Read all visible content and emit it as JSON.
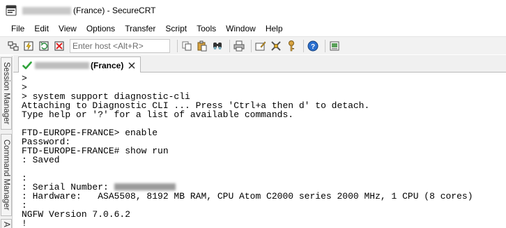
{
  "window": {
    "title_suffix": "(France) - SecureCRT",
    "app_icon": "securecrt-icon"
  },
  "menu": {
    "items": [
      "File",
      "Edit",
      "View",
      "Options",
      "Transfer",
      "Script",
      "Tools",
      "Window",
      "Help"
    ]
  },
  "toolbar": {
    "host_placeholder": "Enter host <Alt+R>",
    "icons": [
      "connect-icon",
      "quick-connect-icon",
      "reconnect-icon",
      "disconnect-icon",
      "copy-icon",
      "paste-icon",
      "find-icon",
      "print-icon",
      "session-options-icon",
      "global-options-icon",
      "keymap-icon",
      "help-icon",
      "screenshot-icon"
    ]
  },
  "side_panel": {
    "tabs": [
      "Session Manager",
      "Command Manager",
      "A"
    ]
  },
  "session_tab": {
    "label": "(France)",
    "status_color": "#2fa33b"
  },
  "terminal": {
    "lines": [
      ">",
      ">",
      "> system support diagnostic-cli",
      "Attaching to Diagnostic CLI ... Press 'Ctrl+a then d' to detach.",
      "Type help or '?' for a list of available commands.",
      "",
      "FTD-EUROPE-FRANCE> enable",
      "Password:",
      "FTD-EUROPE-FRANCE# show run",
      ": Saved",
      "",
      ":",
      ": Serial Number: ",
      ": Hardware:   ASA5508, 8192 MB RAM, CPU Atom C2000 series 2000 MHz, 1 CPU (8 cores)",
      ":",
      "NGFW Version 7.0.6.2",
      "!"
    ]
  }
}
